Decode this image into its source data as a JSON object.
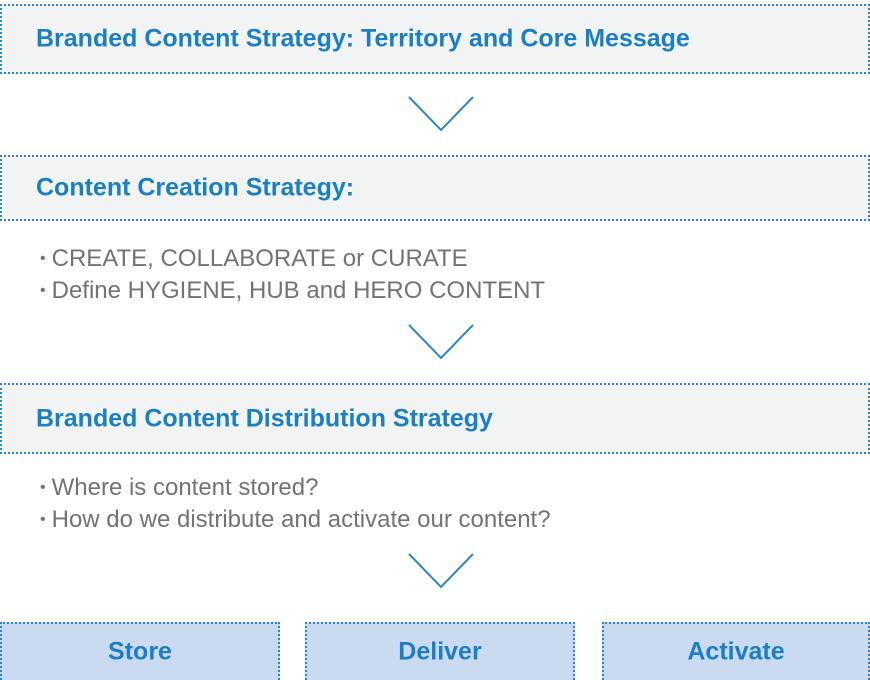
{
  "stages": [
    {
      "title": "Branded Content Strategy: Territory and Core Message",
      "bullets": []
    },
    {
      "title": "Content Creation Strategy:",
      "bullets": [
        "CREATE, COLLABORATE or CURATE",
        "Define HYGIENE, HUB and HERO CONTENT"
      ]
    },
    {
      "title": "Branded Content Distribution Strategy",
      "bullets": [
        "Where is content stored?",
        "How do we distribute and activate our content?"
      ]
    }
  ],
  "actions": [
    "Store",
    "Deliver",
    "Activate"
  ],
  "bullet_glyph": "•",
  "colors": {
    "title_text": "#1a7fc4",
    "box_border": "#2e86c8",
    "stage_fill": "#f2f4f4",
    "action_fill": "#c9daf1",
    "bullet_text": "#737373",
    "chevron": "#2e86c8"
  },
  "icons": {
    "connector": "chevron-down-icon"
  }
}
